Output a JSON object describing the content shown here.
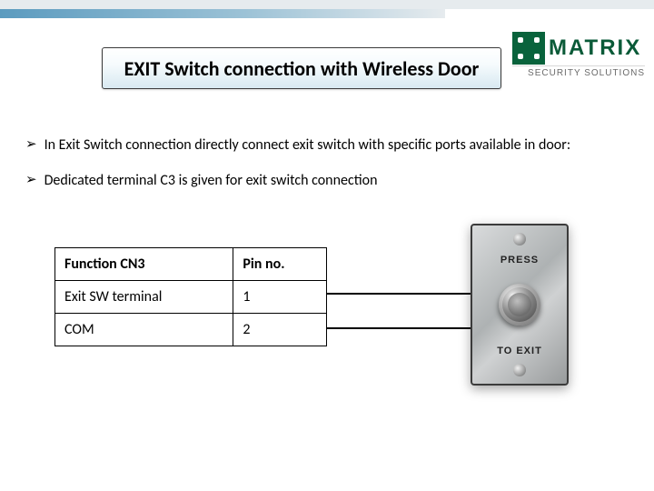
{
  "logo": {
    "brand": "MATRIX",
    "tagline": "SECURITY SOLUTIONS"
  },
  "title": "EXIT Switch connection with Wireless Door",
  "bullets": [
    "In Exit Switch connection directly connect exit switch with specific ports available in door:",
    "Dedicated terminal C3 is given for exit switch connection"
  ],
  "table": {
    "headers": [
      "Function CN3",
      "Pin no."
    ],
    "rows": [
      [
        "Exit SW terminal",
        "1"
      ],
      [
        "COM",
        "2"
      ]
    ]
  },
  "switch_plate": {
    "label_top": "PRESS",
    "label_bottom": "TO EXIT"
  }
}
